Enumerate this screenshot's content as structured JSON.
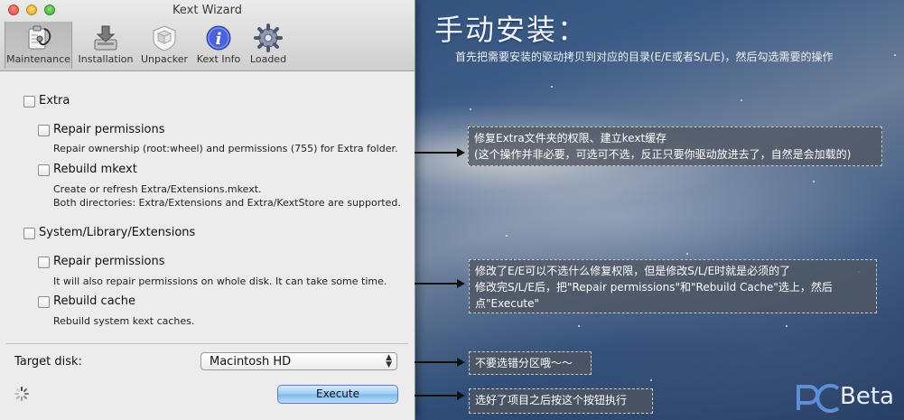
{
  "window": {
    "title": "Kext Wizard"
  },
  "toolbar": {
    "items": [
      {
        "label": "Maintenance",
        "icon": "stethoscope-icon",
        "active": true
      },
      {
        "label": "Installation",
        "icon": "install-tray-icon"
      },
      {
        "label": "Unpacker",
        "icon": "shield-box-icon"
      },
      {
        "label": "Kext Info",
        "icon": "info-icon"
      },
      {
        "label": "Loaded",
        "icon": "gear-icon"
      }
    ]
  },
  "extra": {
    "label": "Extra",
    "repair": {
      "label": "Repair permissions",
      "desc": "Repair ownership (root:wheel) and permissions (755) for Extra folder."
    },
    "rebuild": {
      "label": "Rebuild mkext",
      "desc1": "Create or refresh Extra/Extensions.mkext.",
      "desc2": "Both directories: Extra/Extensions and Extra/KextStore are supported."
    }
  },
  "sle": {
    "label": "System/Library/Extensions",
    "repair": {
      "label": "Repair permissions",
      "desc": "It will also repair permissions on whole disk. It can take some time."
    },
    "rebuild": {
      "label": "Rebuild cache",
      "desc": "Rebuild system kext caches."
    }
  },
  "target": {
    "label": "Target disk:",
    "value": "Macintosh HD"
  },
  "execute_label": "Execute",
  "annotations": {
    "heading": "手动安装：",
    "subtitle": "首先把需要安装的驱动拷贝到对应的目录(E/E或者S/L/E)，然后勾选需要的操作",
    "note1": {
      "line1": "修复Extra文件夹的权限、建立kext缓存",
      "line2": "(这个操作并非必要，可选可不选，反正只要你驱动放进去了，自然是会加载的)"
    },
    "note2": {
      "line1": "修改了E/E可以不选什么修复权限，但是修改S/L/E时就是必须的了",
      "line2": "修改完S/L/E后，把\"Repair permissions\"和\"Rebuild Cache\"选上，然后",
      "line3": "点\"Execute\""
    },
    "note3": "不要选错分区哦～～",
    "note4": "选好了项目之后按这个按钮执行"
  },
  "watermark": {
    "text": "Beta"
  },
  "colors": {
    "execute_button": "#9ccbf6",
    "note_bg": "#50566099",
    "accent_heading": "#eef4ff"
  }
}
